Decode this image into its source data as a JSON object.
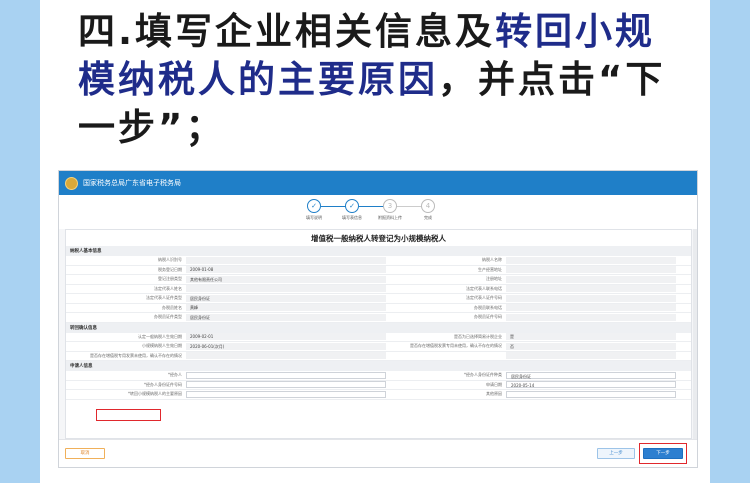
{
  "heading": {
    "part1": "四.填写企业相关信息及",
    "part2": "转回小规模纳税人的主要原因",
    "part3": "，并点击“下一步”；"
  },
  "app": {
    "title": "国家税务总局广东省电子税务局",
    "form_title": "增值税一般纳税人转登记为小规模纳税人"
  },
  "steps": [
    {
      "num": "✓",
      "label": "填写说明"
    },
    {
      "num": "✓",
      "label": "填写表信息"
    },
    {
      "num": "3",
      "label": "附报资料上传"
    },
    {
      "num": "4",
      "label": "完成"
    }
  ],
  "sections": {
    "basic": "纳税人基本信息",
    "transfer": "转回确认信息",
    "applicant": "申请人信息"
  },
  "basic_rows": [
    {
      "l1": "纳税人识别号",
      "v1": "",
      "l2": "纳税人名称",
      "v2": ""
    },
    {
      "l1": "税务登记日期",
      "v1": "2009-01-08",
      "l2": "生产经营地址",
      "v2": ""
    },
    {
      "l1": "登记注册类型",
      "v1": "其他有限责任公司",
      "l2": "注册地址",
      "v2": ""
    },
    {
      "l1": "法定代表人姓名",
      "v1": "",
      "l2": "法定代表人联系电话",
      "v2": ""
    },
    {
      "l1": "法定代表人证件类型",
      "v1": "居民身份证",
      "l2": "法定代表人证件号码",
      "v2": ""
    },
    {
      "l1": "办税员姓名",
      "v1": "黄峰",
      "l2": "办税员联系电话",
      "v2": ""
    },
    {
      "l1": "办税员证件类型",
      "v1": "居民身份证",
      "l2": "办税员证件号码",
      "v2": ""
    }
  ],
  "transfer_rows": [
    {
      "l1": "认定一般纳税人生效日期",
      "v1": "2009-02-01",
      "l2": "是否为已选择简易计税企业",
      "v2": "是"
    },
    {
      "l1": "小规模纳税人生效日期",
      "v1": "2020-06-01(次月)",
      "l2": "是否存在增值税发票专用未使用，确认不存在的情况",
      "v2": "否"
    },
    {
      "l1": "是否存在增值税专用发票未使用，确认不存在的情况",
      "v1": "",
      "l2": "",
      "v2": ""
    }
  ],
  "applicant_rows": [
    {
      "l1": "*经办人",
      "v1": "",
      "l2": "*经办人身份证件种类",
      "v2": "居民身份证"
    },
    {
      "l1": "*经办人身份证件号码",
      "v1": "",
      "l2": "申请日期",
      "v2": "2020-05-14"
    },
    {
      "l1": "*转回小规模纳税人的主要原因",
      "v1": "",
      "l2": "其他原因",
      "v2": ""
    }
  ],
  "buttons": {
    "cancel": "取消",
    "prev": "上一步",
    "next": "下一步"
  },
  "colors": {
    "side": "#a9d2f2",
    "heading_highlight": "#1f2c8a",
    "topbar": "#1f7fc8",
    "highlight_box": "#e0282d"
  }
}
